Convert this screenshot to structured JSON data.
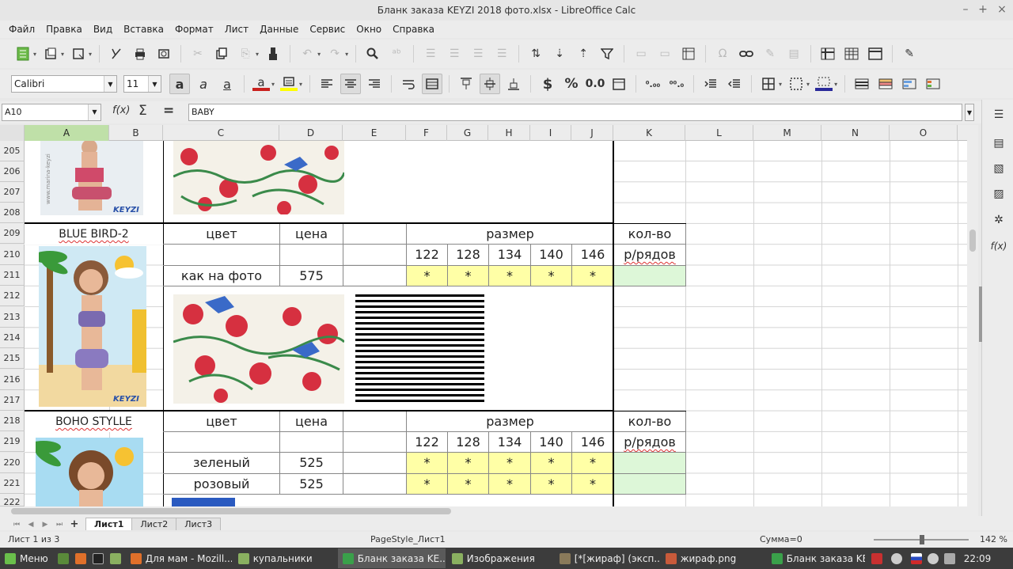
{
  "window": {
    "title": "Бланк заказа KEYZI 2018 фото.xlsx - LibreOffice Calc",
    "minimize": "–",
    "maximize": "+",
    "close": "×"
  },
  "menu": [
    "Файл",
    "Правка",
    "Вид",
    "Вставка",
    "Формат",
    "Лист",
    "Данные",
    "Сервис",
    "Окно",
    "Справка"
  ],
  "font": {
    "name": "Calibri",
    "size": "11"
  },
  "toolbar2": {
    "currency": "$",
    "percent": "%",
    "number": "0.0"
  },
  "formula": {
    "cell_ref": "A10",
    "fx": "f(x)",
    "sum": "Σ",
    "eq": "=",
    "content": "BABY"
  },
  "columns": [
    "A",
    "B",
    "C",
    "D",
    "E",
    "F",
    "G",
    "H",
    "I",
    "J",
    "K",
    "L",
    "M",
    "N",
    "O"
  ],
  "rows": [
    "205",
    "206",
    "207",
    "208",
    "209",
    "210",
    "211",
    "212",
    "213",
    "214",
    "215",
    "216",
    "217",
    "218",
    "219",
    "220",
    "221",
    "222"
  ],
  "block1": {
    "name": "BLUE BIRD-2",
    "color_hdr": "цвет",
    "price_hdr": "цена",
    "size_hdr": "размер",
    "qty_hdr1": "кол-во",
    "qty_hdr2": "р/рядов",
    "sizes": [
      "122",
      "128",
      "134",
      "140",
      "146"
    ],
    "items": [
      {
        "color": "как на фото",
        "price": "575",
        "marks": [
          "*",
          "*",
          "*",
          "*",
          "*"
        ]
      }
    ]
  },
  "block2": {
    "name": "BOHO STYLLE",
    "color_hdr": "цвет",
    "price_hdr": "цена",
    "size_hdr": "размер",
    "qty_hdr1": "кол-во",
    "qty_hdr2": "р/рядов",
    "sizes": [
      "122",
      "128",
      "134",
      "140",
      "146"
    ],
    "items": [
      {
        "color": "зеленый",
        "price": "525",
        "marks": [
          "*",
          "*",
          "*",
          "*",
          "*"
        ]
      },
      {
        "color": "розовый",
        "price": "525",
        "marks": [
          "*",
          "*",
          "*",
          "*",
          "*"
        ]
      }
    ]
  },
  "tabs": [
    "Лист1",
    "Лист2",
    "Лист3"
  ],
  "status": {
    "sheet": "Лист 1 из 3",
    "style": "PageStyle_Лист1",
    "sum": "Сумма=0",
    "zoom": "142 %"
  },
  "taskbar": {
    "start": "Меню",
    "tasks": [
      "Для мам - Mozill...",
      "купальники",
      "Бланк заказа KE...",
      "Изображения",
      "[*[жираф] (эксп...",
      "жираф.png",
      "Бланк заказа KE..."
    ],
    "clock": "22:09"
  },
  "colors": {
    "yellow": "#ffffa6",
    "green": "#ddf7d8",
    "selected_col": "#bfe0a8"
  }
}
